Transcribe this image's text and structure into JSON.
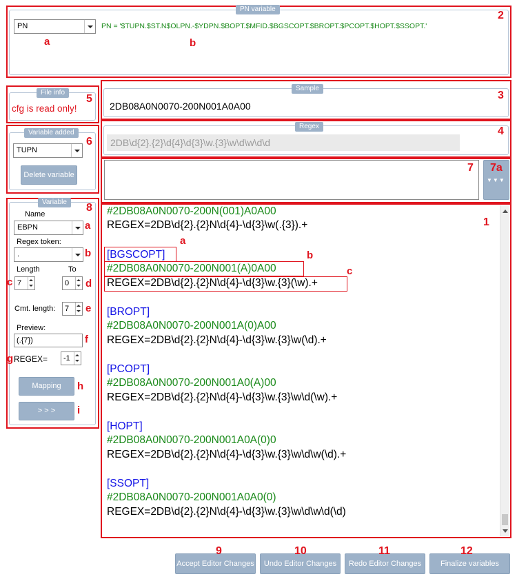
{
  "pn_variable": {
    "legend": "PN variable",
    "selected": "PN",
    "expression": "PN = '$TUPN.$ST.N$OLPN.-$YDPN.$BOPT.$MFID.$BGSCOPT.$BROPT.$PCOPT.$HOPT.$SSOPT.'"
  },
  "file_info": {
    "legend": "File info",
    "message": "cfg is read only!"
  },
  "variable_added": {
    "legend": "Variable added",
    "selected": "TUPN",
    "delete_label": "Delete variable"
  },
  "variable_panel": {
    "legend": "Variable",
    "name_label": "Name",
    "name_value": "EBPN",
    "regex_token_label": "Regex token:",
    "regex_token_value": ".",
    "length_label": "Length",
    "to_label": "To",
    "length_value": "7",
    "to_value": "0",
    "cmt_length_label": "Cmt. length:",
    "cmt_length_value": "7",
    "preview_label": "Preview:",
    "preview_value": "(.{7})",
    "regex_label": "REGEX=",
    "regex_value": "-1",
    "mapping_label": "Mapping",
    "arrow_label": "> > >"
  },
  "sample": {
    "legend": "Sample",
    "value": "2DB08A0N0070-200N001A0A00"
  },
  "regex": {
    "legend": "Regex",
    "value": "2DB\\d{2}.{2}\\d{4}\\d{3}\\w.{3}\\w\\d\\w\\d\\d"
  },
  "expand_button": {
    "label": "▼▼▼"
  },
  "editor": {
    "lines": [
      {
        "text": "#2DB08A0N0070-200N(001)A0A00",
        "color": "green"
      },
      {
        "text": "REGEX=2DB\\d{2}.{2}N\\d{4}-\\d{3}\\w(.{3}).+",
        "color": "black"
      },
      {
        "text": "[BGSCOPT]",
        "color": "blue"
      },
      {
        "text": "#2DB08A0N0070-200N001(A)0A00",
        "color": "green"
      },
      {
        "text": "REGEX=2DB\\d{2}.{2}N\\d{4}-\\d{3}\\w.{3}(\\w).+",
        "color": "black"
      },
      {
        "text": "[BROPT]",
        "color": "blue"
      },
      {
        "text": "#2DB08A0N0070-200N001A(0)A00",
        "color": "green"
      },
      {
        "text": "REGEX=2DB\\d{2}.{2}N\\d{4}-\\d{3}\\w.{3}\\w(\\d).+",
        "color": "black"
      },
      {
        "text": "[PCOPT]",
        "color": "blue"
      },
      {
        "text": "#2DB08A0N0070-200N001A0(A)00",
        "color": "green"
      },
      {
        "text": "REGEX=2DB\\d{2}.{2}N\\d{4}-\\d{3}\\w.{3}\\w\\d(\\w).+",
        "color": "black"
      },
      {
        "text": "[HOPT]",
        "color": "blue"
      },
      {
        "text": "#2DB08A0N0070-200N001A0A(0)0",
        "color": "green"
      },
      {
        "text": "REGEX=2DB\\d{2}.{2}N\\d{4}-\\d{3}\\w.{3}\\w\\d\\w(\\d).+",
        "color": "black"
      },
      {
        "text": "[SSOPT]",
        "color": "blue"
      },
      {
        "text": "#2DB08A0N0070-200N001A0A0(0)",
        "color": "green"
      },
      {
        "text": "REGEX=2DB\\d{2}.{2}N\\d{4}-\\d{3}\\w.{3}\\w\\d\\w\\d(\\d)",
        "color": "black"
      }
    ]
  },
  "footer_buttons": {
    "accept": "Accept Editor Changes",
    "undo": "Undo Editor Changes",
    "redo": "Redo Editor Changes",
    "finalize": "Finalize variables"
  },
  "annotations": {
    "n1": "1",
    "n2": "2",
    "n3": "3",
    "n4": "4",
    "n5": "5",
    "n6": "6",
    "n7": "7",
    "n7a": "7a",
    "n8": "8",
    "n9": "9",
    "n10": "10",
    "n11": "11",
    "n12": "12",
    "a": "a",
    "b": "b",
    "c": "c",
    "d": "d",
    "e": "e",
    "f": "f",
    "g": "g",
    "h": "h",
    "i": "i"
  },
  "colors": {
    "accent": "#9db2c9",
    "annotation": "#e0141e",
    "keyword": "#1414e6",
    "comment": "#1a8a1a"
  }
}
